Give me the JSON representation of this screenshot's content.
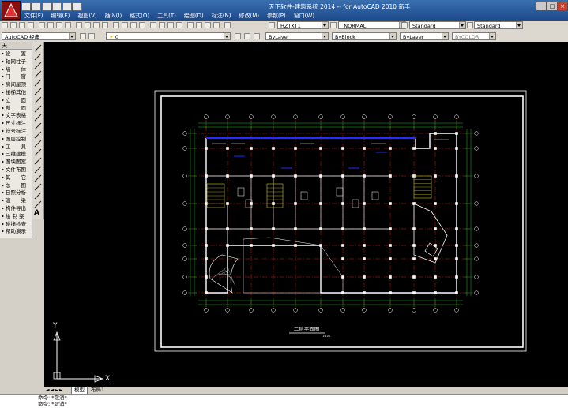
{
  "window": {
    "title": "天正软件-建筑系统 2014 -- for AutoCAD 2010   新手"
  },
  "menu": [
    "文件(F)",
    "编辑(E)",
    "视图(V)",
    "插入(I)",
    "格式(O)",
    "工具(T)",
    "绘图(D)",
    "标注(N)",
    "修改(M)",
    "参数(P)",
    "窗口(W)"
  ],
  "toolbar": {
    "text_style": "HZTXT1",
    "dim_style": "_NORMAL",
    "table_style": "Standard",
    "mleader_style": "Standard",
    "workspace": "AutoCAD 经典",
    "layer": "0",
    "color": "ByLayer",
    "linetype": "ByBlock",
    "lineweight": "ByLayer",
    "plotstyle": "BYCOLOR"
  },
  "sidebar": {
    "title": "天...",
    "items": [
      "设　　置",
      "轴网柱子",
      "墙　　体",
      "门　　窗",
      "房间屋顶",
      "楼梯其他",
      "立　　面",
      "剖　　面",
      "文字表格",
      "尺寸标注",
      "符号标注",
      "图层控制",
      "工　　具",
      "三维建模",
      "图块图案",
      "文件布图",
      "其　　它",
      "总　　图",
      "日照分析",
      "渲　　染",
      "构件导出",
      "绘 制 梁",
      "碰撞检查",
      "帮助演示"
    ]
  },
  "drawing": {
    "title": "二层平面图",
    "scale": "1:100"
  },
  "ucs": {
    "x": "X",
    "y": "Y"
  },
  "layout_tabs": [
    "模型",
    "布局1"
  ],
  "command": {
    "lines": [
      "命令: *取消*",
      "命令: *取消*"
    ]
  },
  "colors": {
    "canvas": "#000000",
    "title_bg": "#1c4a8a",
    "grid": "#d01818",
    "wall": "#ffffff",
    "dim": "#20c020",
    "column": "#2828ff",
    "accent": "#c8c820"
  }
}
